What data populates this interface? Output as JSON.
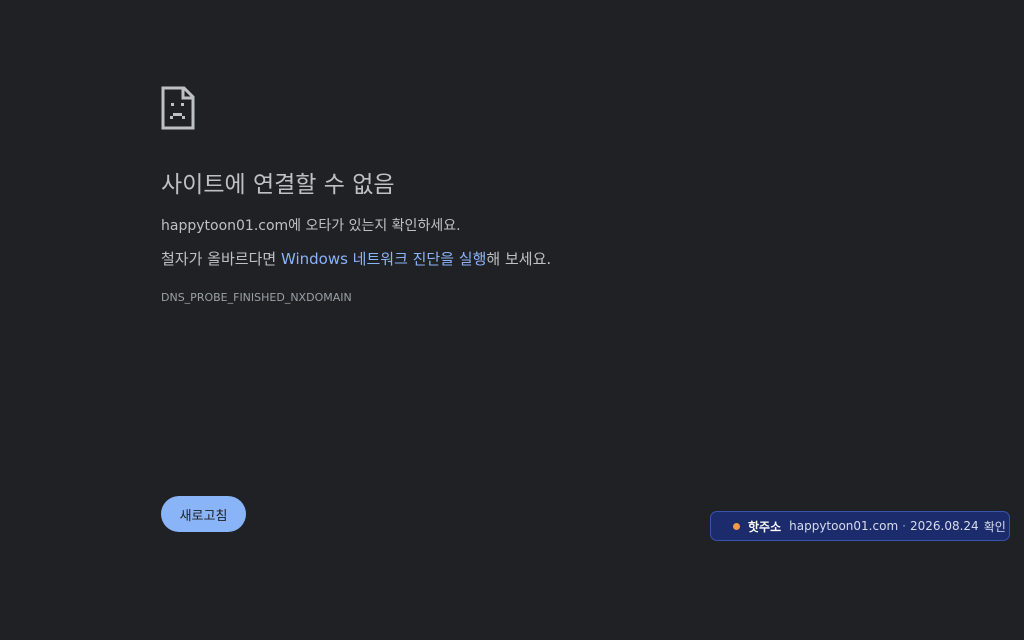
{
  "error": {
    "icon": "sad-document-icon",
    "title": "사이트에 연결할 수 없음",
    "line1_domain": "happytoon01.com",
    "line1_rest": "에 오타가 있는지 확인하세요.",
    "line2_prefix": "철자가 올바르다면 ",
    "line2_link": "Windows 네트워크 진단을 실행",
    "line2_suffix": "해 보세요.",
    "code": "DNS_PROBE_FINISHED_NXDOMAIN"
  },
  "reload": {
    "label": "새로고침"
  },
  "badge": {
    "label": "핫주소",
    "domain": "happytoon01.com",
    "separator": "·",
    "date": "2026.08.24",
    "status": "확인"
  },
  "colors": {
    "background": "#202124",
    "text": "#bdc1c6",
    "link": "#8ab4f8",
    "button": "#8ab4f8",
    "badge_bg": "#1b2b6b",
    "badge_dot": "#f2994a"
  }
}
